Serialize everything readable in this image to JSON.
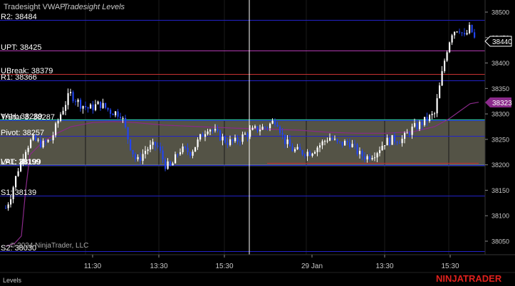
{
  "chart_title": {
    "main": "Tradesight VWAP,",
    "secondary": "Tradesight Levels"
  },
  "tab_label": "Levels",
  "brand": "NINJATRADER",
  "copyright": "© 2024 NinjaTrader, LLC",
  "colors": {
    "background": "#000000",
    "blue_level": "#2222c8",
    "purple_level": "#b03ab0",
    "red_level": "#c83232",
    "value_area_fill": "#58574a",
    "vah_line": "#2ab89a",
    "val_line": "#8fc8ff",
    "vwap_line": "#8a2a8a",
    "candle_white": "#ffffff",
    "candle_blue": "#2244ee",
    "cursor": "#ffffff",
    "brand_red": "#e0201c",
    "price_box_purple": "#8b2a8b"
  },
  "chart_data": {
    "type": "candlestick",
    "ylim": [
      38030,
      38510
    ],
    "y_ticks": [
      "38500",
      "38450",
      "38400",
      "38350",
      "38300",
      "38250",
      "38200",
      "38150",
      "38100",
      "38050"
    ],
    "x_ticks": [
      "11:30",
      "13:30",
      "15:30",
      "29 Jan",
      "13:30",
      "15:30"
    ],
    "levels": [
      {
        "label": "R2: 38484",
        "value": 38484,
        "color": "blue"
      },
      {
        "label": "UPT: 38425",
        "value": 38425,
        "color": "purple"
      },
      {
        "label": "UBreak: 38379",
        "value": 38379,
        "color": "red"
      },
      {
        "label": "R1: 38366",
        "value": 38366,
        "color": "blue"
      },
      {
        "label": "VAH: 38289",
        "value": 38289,
        "color": "vah"
      },
      {
        "label": "TrStar 3: 38287",
        "value": 38287,
        "color": "blue"
      },
      {
        "label": "Pivot: 38257",
        "value": 38257,
        "color": "blue"
      },
      {
        "label": "VAL: 38199",
        "value": 38199,
        "color": "val"
      },
      {
        "label": "LPT: 38199",
        "value": 38199,
        "color": "blue"
      },
      {
        "label": "S1: 38139",
        "value": 38139,
        "color": "blue"
      },
      {
        "label": "S2: 38030",
        "value": 38030,
        "color": "blue"
      }
    ],
    "last_price": "38440",
    "vwap_value": "38323"
  }
}
